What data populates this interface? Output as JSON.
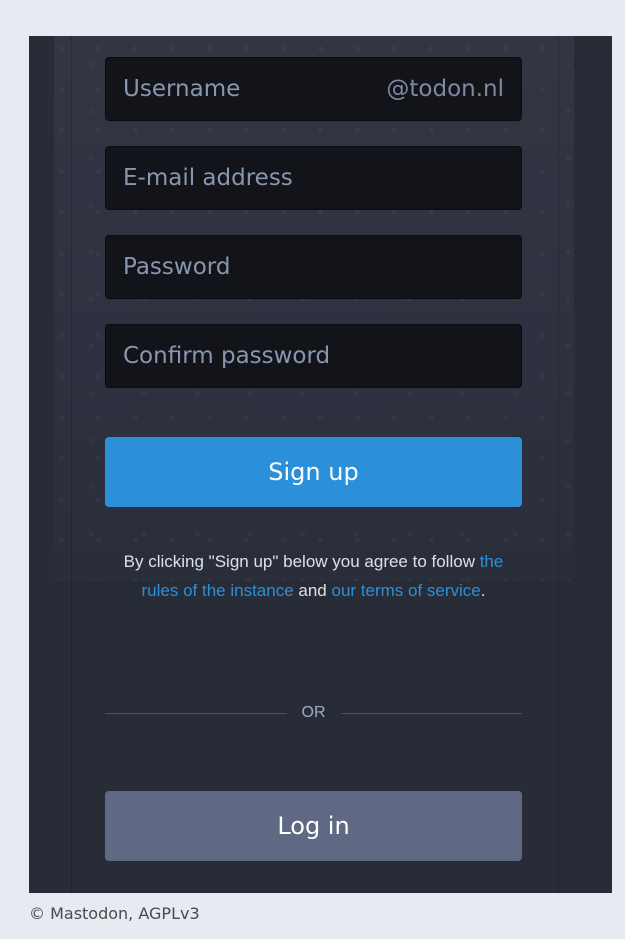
{
  "form": {
    "username_placeholder": "Username",
    "username_suffix": "@todon.nl",
    "email_placeholder": "E-mail address",
    "password_placeholder": "Password",
    "confirm_password_placeholder": "Confirm password",
    "signup_label": "Sign up",
    "agreement_prefix": "By clicking \"Sign up\" below you agree to follow ",
    "rules_link": "the rules of the instance",
    "agreement_middle": " and ",
    "terms_link": "our terms of service",
    "agreement_suffix": ".",
    "divider_label": "OR",
    "login_label": "Log in"
  },
  "footer": {
    "credit": "© Mastodon, AGPLv3"
  },
  "colors": {
    "accent": "#2b90d9",
    "login_button": "#606984",
    "panel_background": "#282c37",
    "input_background": "#131419",
    "page_background": "#e6ebf2"
  }
}
